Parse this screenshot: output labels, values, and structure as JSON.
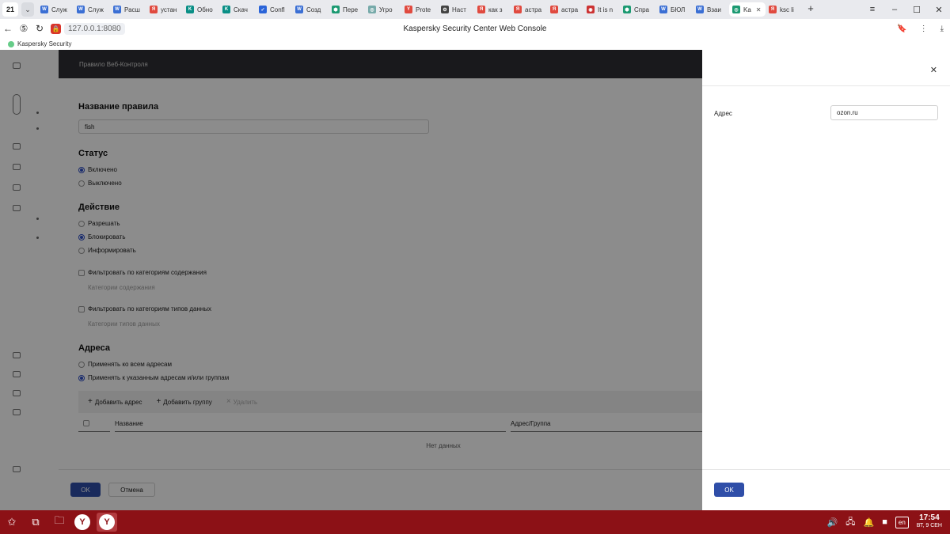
{
  "browser": {
    "tab_count": "21",
    "tabs": [
      {
        "label": "Служ",
        "color": "#3b6fd4",
        "glyph": "W"
      },
      {
        "label": "Служ",
        "color": "#3b6fd4",
        "glyph": "W"
      },
      {
        "label": "Расш",
        "color": "#3b6fd4",
        "glyph": "W"
      },
      {
        "label": "устан",
        "color": "#e04a3f",
        "glyph": "Я"
      },
      {
        "label": "Обно",
        "color": "#0a8f86",
        "glyph": "K"
      },
      {
        "label": "Скач",
        "color": "#0a8f86",
        "glyph": "K"
      },
      {
        "label": "Confl",
        "color": "#2b64d8",
        "glyph": "✓"
      },
      {
        "label": "Созд",
        "color": "#3b6fd4",
        "glyph": "W"
      },
      {
        "label": "Пере",
        "color": "#1c9a72",
        "glyph": "⬢"
      },
      {
        "label": "Угро",
        "color": "#7aa",
        "glyph": "◎"
      },
      {
        "label": "Prote",
        "color": "#e04a3f",
        "glyph": "Y"
      },
      {
        "label": "Наст",
        "color": "#444",
        "glyph": "⚙"
      },
      {
        "label": "как з",
        "color": "#e04a3f",
        "glyph": "Я"
      },
      {
        "label": "астра",
        "color": "#e04a3f",
        "glyph": "Я"
      },
      {
        "label": "астра",
        "color": "#e04a3f",
        "glyph": "Я"
      },
      {
        "label": "It is n",
        "color": "#c33",
        "glyph": "◉"
      },
      {
        "label": "Спра",
        "color": "#1c9a72",
        "glyph": "⬢"
      },
      {
        "label": "БЮЛ",
        "color": "#3b6fd4",
        "glyph": "W"
      },
      {
        "label": "Взаи",
        "color": "#3b6fd4",
        "glyph": "W"
      },
      {
        "label": "Ka",
        "color": "#1c9a72",
        "glyph": "◎",
        "active": true
      },
      {
        "label": "ksc li",
        "color": "#e04a3f",
        "glyph": "Я"
      }
    ],
    "url": "127.0.0.1:8080",
    "page_title": "Kaspersky Security Center Web Console",
    "bookmark": "Kaspersky Security"
  },
  "dialog": {
    "header": "Правило Веб-Контроля",
    "rule_name_title": "Название правила",
    "rule_name_value": "fish",
    "status_title": "Статус",
    "status_options": [
      {
        "label": "Включено",
        "selected": true
      },
      {
        "label": "Выключено",
        "selected": false
      }
    ],
    "action_title": "Действие",
    "action_options": [
      {
        "label": "Разрешать",
        "selected": false
      },
      {
        "label": "Блокировать",
        "selected": true
      },
      {
        "label": "Информировать",
        "selected": false
      }
    ],
    "filter_content_label": "Фильтровать по категориям содержания",
    "content_categories_hint": "Категории содержания",
    "filter_datatypes_label": "Фильтровать по категориям типов данных",
    "datatype_categories_hint": "Категории типов данных",
    "addresses_title": "Адреса",
    "address_options": [
      {
        "label": "Применять ко всем адресам",
        "selected": false
      },
      {
        "label": "Применять к указанным адресам и/или группам",
        "selected": true
      }
    ],
    "toolbar": {
      "add_address": "Добавить адрес",
      "add_group": "Добавить группу",
      "delete": "Удалить"
    },
    "columns": {
      "name": "Название",
      "address_group": "Адрес/Группа"
    },
    "no_data": "Нет данных",
    "ok": "OK",
    "cancel": "Отмена"
  },
  "panel": {
    "address_label": "Адрес",
    "address_value": "ozon.ru",
    "ok": "OK"
  },
  "taskbar": {
    "lang": "en",
    "time": "17:54",
    "date": "ВТ, 9 СЕН"
  },
  "colors": {
    "accent": "#2f4ea8",
    "taskbar": "#8c1116",
    "dialog_header": "#2e2e33"
  }
}
